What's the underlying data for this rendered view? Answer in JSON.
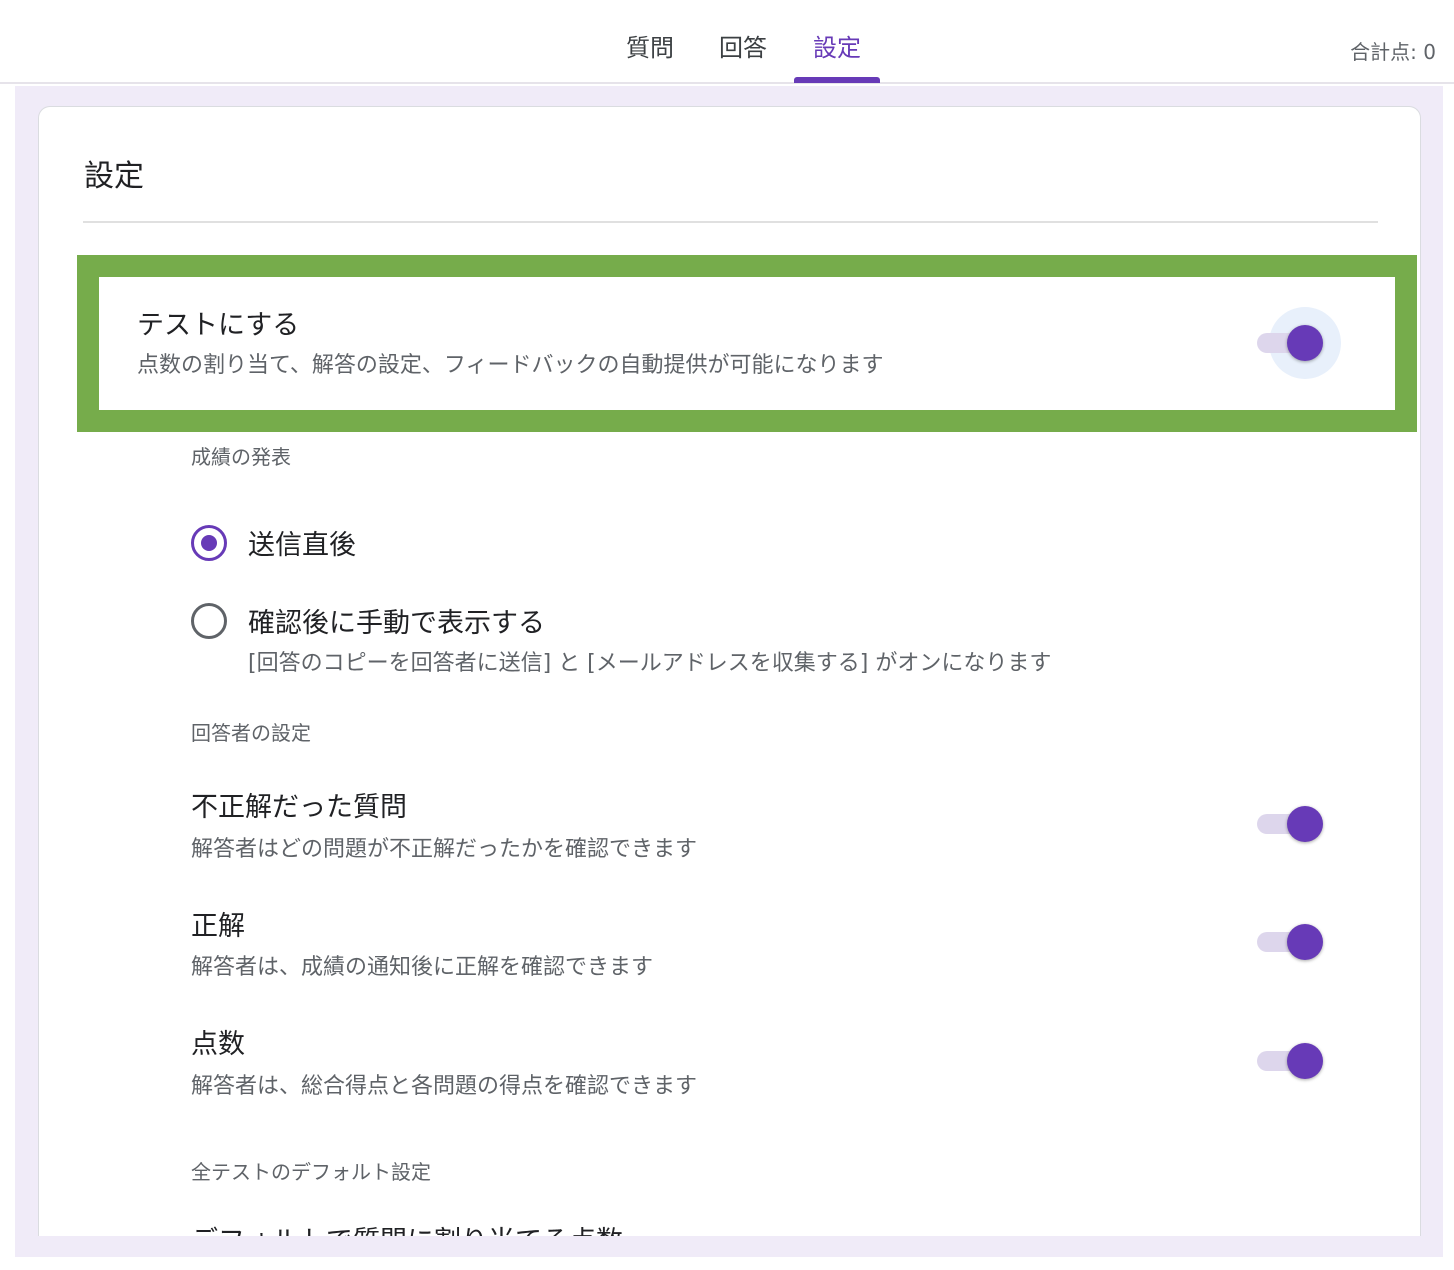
{
  "tabs": [
    {
      "label": "質問",
      "active": false
    },
    {
      "label": "回答",
      "active": false
    },
    {
      "label": "設定",
      "active": true
    }
  ],
  "score_label": "合計点: 0",
  "card": {
    "title": "設定",
    "quiz": {
      "title": "テストにする",
      "description": "点数の割り当て、解答の設定、フィードバックの自動提供が可能になります",
      "enabled": true
    },
    "release_section": {
      "label": "成績の発表",
      "options": [
        {
          "label": "送信直後",
          "selected": true
        },
        {
          "label": "確認後に手動で表示する",
          "selected": false,
          "sub": "[回答のコピーを回答者に送信] と [メールアドレスを収集する] がオンになります"
        }
      ]
    },
    "respondent_section": {
      "label": "回答者の設定",
      "items": [
        {
          "title": "不正解だった質問",
          "description": "解答者はどの問題が不正解だったかを確認できます",
          "enabled": true
        },
        {
          "title": "正解",
          "description": "解答者は、成績の通知後に正解を確認できます",
          "enabled": true
        },
        {
          "title": "点数",
          "description": "解答者は、総合得点と各問題の得点を確認できます",
          "enabled": true
        }
      ]
    },
    "defaults_section": {
      "label": "全テストのデフォルト設定",
      "next_item": "デフォルトで質問に割り当てる点数"
    }
  },
  "colors": {
    "accent": "#673ab7",
    "highlight_border": "#76ac4b",
    "backdrop": "#f0ebf8"
  }
}
